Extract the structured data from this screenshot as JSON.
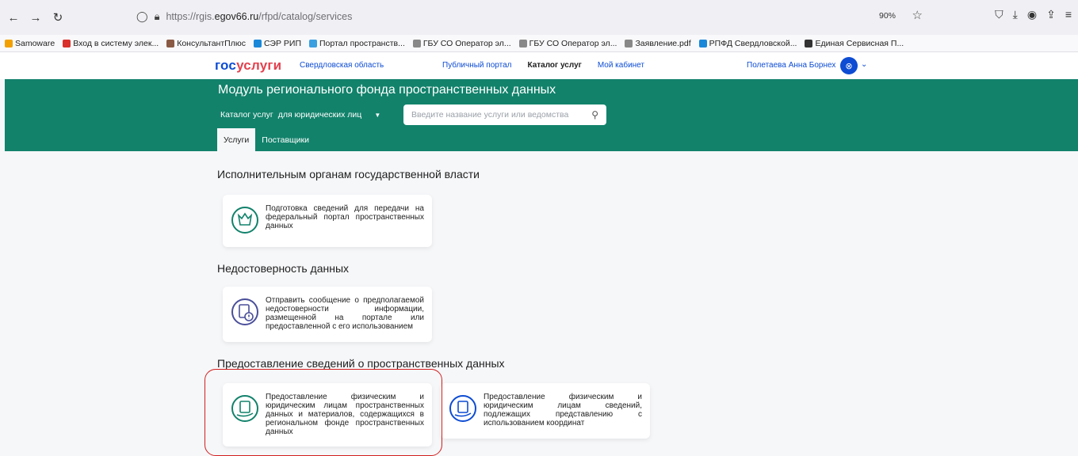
{
  "browser": {
    "url_prefix": "https://rgis.",
    "url_domain": "egov66.ru",
    "url_path": "/rfpd/catalog/services",
    "zoom": "90%"
  },
  "bookmarks": [
    {
      "label": "Samoware",
      "color": "#f2a000"
    },
    {
      "label": "Вход в систему элек...",
      "color": "#d9302b"
    },
    {
      "label": "КонсультантПлюс",
      "color": "#8a5a44"
    },
    {
      "label": "СЭР РИП",
      "color": "#1a88d8"
    },
    {
      "label": "Портал пространств...",
      "color": "#3aa0e0"
    },
    {
      "label": "ГБУ СО Оператор эл...",
      "color": "#888888"
    },
    {
      "label": "ГБУ СО Оператор эл...",
      "color": "#888888"
    },
    {
      "label": "Заявление.pdf",
      "color": "#888888"
    },
    {
      "label": "РПФД Свердловской...",
      "color": "#1a88d8"
    },
    {
      "label": "Единая Сервисная П...",
      "color": "#333333"
    }
  ],
  "header": {
    "logo_a": "гос",
    "logo_b": "услуги",
    "region": "Свердловская область",
    "nav": [
      "Публичный портал",
      "Каталог услуг",
      "Мой кабинет"
    ],
    "user": "Полетаева Анна Борнех"
  },
  "banner": {
    "title": "Модуль регионального фонда пространственных данных",
    "catalog_label": "Каталог услуг",
    "catalog_select": "для юридических лиц",
    "search_placeholder": "Введите название услуги или ведомства",
    "tabs": [
      "Услуги",
      "Поставщики"
    ]
  },
  "sections": [
    {
      "title": "Исполнительным органам государственной власти",
      "cards": [
        "Подготовка сведений для передачи на федеральный портал пространственных данных"
      ]
    },
    {
      "title": "Недостоверность данных",
      "cards": [
        "Отправить сообщение о предполагаемой недостоверности информации, размещенной на портале или предоставленной с его использованием"
      ]
    },
    {
      "title": "Предоставление сведений о пространственных данных",
      "cards": [
        "Предоставление физическим и юридическим лицам пространственных данных и материалов, содержащихся в региональном фонде пространственных данных",
        "Предоставление физическим и юридическим лицам сведений, подлежащих представлению с использованием координат"
      ]
    }
  ],
  "colors": {
    "brand_green": "#12826b",
    "brand_blue": "#0d4cd3",
    "highlight": "#d21e1e"
  }
}
